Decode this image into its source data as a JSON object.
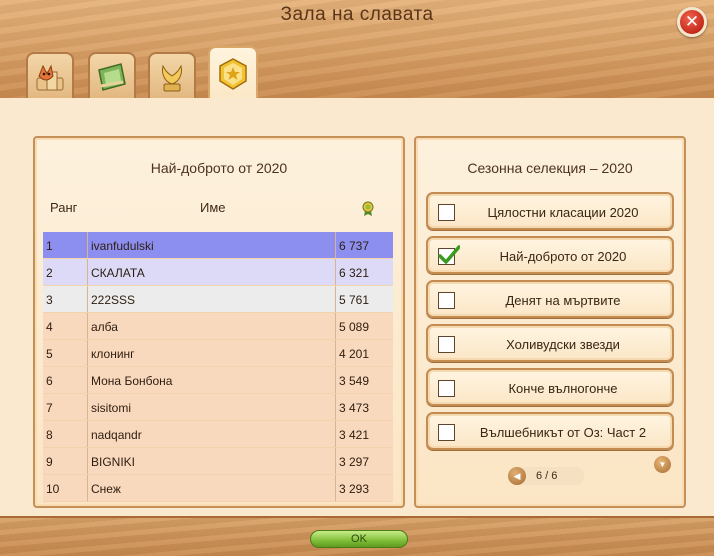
{
  "window": {
    "title": "Зала на славата",
    "close_icon": "close-icon"
  },
  "tabs": [
    {
      "icon": "fox-ranking-icon",
      "active": false
    },
    {
      "icon": "green-card-icon",
      "active": false
    },
    {
      "icon": "golden-wings-icon",
      "active": false
    },
    {
      "icon": "gold-badge-icon",
      "active": true
    }
  ],
  "leaderboard": {
    "title": "Най-доброто от 2020",
    "headers": {
      "rank": "Ранг",
      "name": "Име",
      "score_icon": "medal-icon"
    },
    "rows": [
      {
        "rank": "1",
        "name": "ivanfudulski",
        "score": "6 737"
      },
      {
        "rank": "2",
        "name": "СКАЛАТА",
        "score": "6 321"
      },
      {
        "rank": "3",
        "name": "222SSS",
        "score": "5 761"
      },
      {
        "rank": "4",
        "name": "алба",
        "score": "5 089"
      },
      {
        "rank": "5",
        "name": "клонинг",
        "score": "4 201"
      },
      {
        "rank": "6",
        "name": "Мона Бонбона",
        "score": "3 549"
      },
      {
        "rank": "7",
        "name": "sisitomi",
        "score": "3 473"
      },
      {
        "rank": "8",
        "name": "nadqandr",
        "score": "3 421"
      },
      {
        "rank": "9",
        "name": "BIGNIKI",
        "score": "3 297"
      },
      {
        "rank": "10",
        "name": "Снеж",
        "score": "3 293"
      }
    ]
  },
  "selection": {
    "title": "Сезонна селекция – 2020",
    "items": [
      {
        "label": "Цялостни класации 2020",
        "checked": false
      },
      {
        "label": "Най-доброто от 2020",
        "checked": true
      },
      {
        "label": "Денят на мъртвите",
        "checked": false
      },
      {
        "label": "Холивудски звезди",
        "checked": false
      },
      {
        "label": "Конче вълногонче",
        "checked": false
      },
      {
        "label": "Вълшебникът от Оз: Част 2",
        "checked": false
      }
    ],
    "pager": {
      "text": "6 / 6"
    }
  },
  "footer": {
    "ok_label": "OK"
  },
  "colors": {
    "accent_green": "#7fbe38",
    "close_red": "#c52a1a",
    "row_highlight": "#8c8ff0"
  }
}
